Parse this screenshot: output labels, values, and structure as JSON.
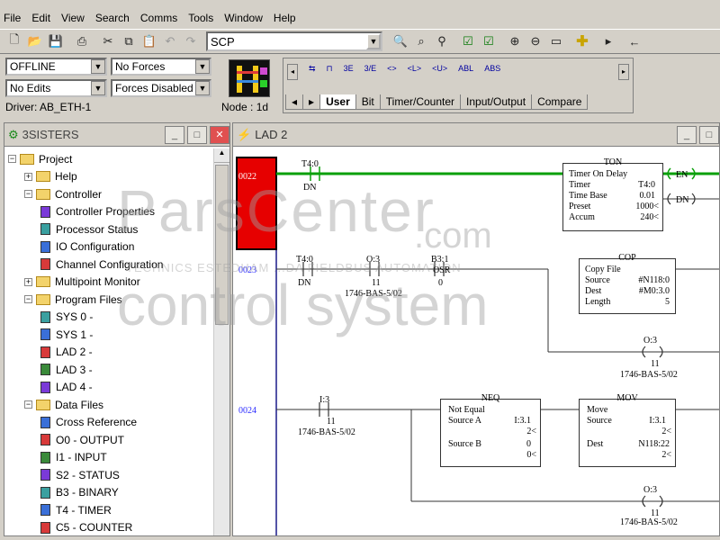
{
  "menu": [
    "File",
    "Edit",
    "View",
    "Search",
    "Comms",
    "Tools",
    "Window",
    "Help"
  ],
  "toolbar": {
    "search_value": "SCP"
  },
  "status": {
    "mode": "OFFLINE",
    "edits": "No Edits",
    "forces": "No Forces",
    "forces_state": "Forces Disabled",
    "driver": "Driver: AB_ETH-1",
    "node": "Node : 1d"
  },
  "instr_icons": [
    "ABL",
    "ABS"
  ],
  "instr_tabs": [
    "User",
    "Bit",
    "Timer/Counter",
    "Input/Output",
    "Compare"
  ],
  "left_pane": {
    "title": "3SISTERS",
    "tree": [
      {
        "label": "Project",
        "level": 0
      },
      {
        "label": "Help",
        "level": 1
      },
      {
        "label": "Controller",
        "level": 1
      },
      {
        "label": "Controller Properties",
        "level": 2
      },
      {
        "label": "Processor Status",
        "level": 2
      },
      {
        "label": "IO Configuration",
        "level": 2
      },
      {
        "label": "Channel Configuration",
        "level": 2
      },
      {
        "label": "Multipoint Monitor",
        "level": 1
      },
      {
        "label": "Program Files",
        "level": 1
      },
      {
        "label": "SYS 0 -",
        "level": 2
      },
      {
        "label": "SYS 1 -",
        "level": 2
      },
      {
        "label": "LAD 2 -",
        "level": 2
      },
      {
        "label": "LAD 3 -",
        "level": 2
      },
      {
        "label": "LAD 4 -",
        "level": 2
      },
      {
        "label": "Data Files",
        "level": 1
      },
      {
        "label": "Cross Reference",
        "level": 2
      },
      {
        "label": "O0 - OUTPUT",
        "level": 2
      },
      {
        "label": "I1 - INPUT",
        "level": 2
      },
      {
        "label": "S2 - STATUS",
        "level": 2
      },
      {
        "label": "B3 - BINARY",
        "level": 2
      },
      {
        "label": "T4 - TIMER",
        "level": 2
      },
      {
        "label": "C5 - COUNTER",
        "level": 2
      }
    ]
  },
  "right_pane": {
    "title": "LAD 2",
    "rungs": {
      "r22": "0022",
      "r23": "0023",
      "r24": "0024"
    },
    "ton": {
      "name": "TON",
      "desc": "Timer On Delay",
      "timer_k": "Timer",
      "timer_v": "T4:0",
      "base_k": "Time Base",
      "base_v": "0.01",
      "preset_k": "Preset",
      "preset_v": "1000<",
      "accum_k": "Accum",
      "accum_v": "240<",
      "en": "EN",
      "dn": "DN"
    },
    "cop": {
      "name": "COP",
      "desc": "Copy File",
      "src_k": "Source",
      "src_v": "#N118:0",
      "dest_k": "Dest",
      "dest_v": "#M0:3.0",
      "len_k": "Length",
      "len_v": "5"
    },
    "neq": {
      "name": "NEQ",
      "desc": "Not Equal",
      "a_k": "Source A",
      "a_v": "I:3.1",
      "a_val": "2<",
      "b_k": "Source B",
      "b_v": "0",
      "b_val": "0<"
    },
    "mov": {
      "name": "MOV",
      "desc": "Move",
      "src_k": "Source",
      "src_v": "I:3.1",
      "src_val": "2<",
      "dest_k": "Dest",
      "dest_v": "N118:22",
      "dest_val": "2<"
    },
    "contacts": {
      "c1_tag": "T4:0",
      "c1_bit": "DN",
      "c2_tag": "T4:0",
      "c2_bit": "DN",
      "c3_tag": "O:3",
      "c3_bit": "11",
      "c3_dev": "1746-BAS-5/02",
      "c4_tag": "B3:1",
      "c4_bit": "0",
      "c4_label": "OSR",
      "c5_tag": "I:3",
      "c5_bit": "11",
      "c5_dev": "1746-BAS-5/02",
      "o1_tag": "O:3",
      "o1_bit": "11",
      "o1_dev": "1746-BAS-5/02",
      "o2_tag": "O:3",
      "o2_bit": "11",
      "o2_dev": "1746-BAS-5/02"
    }
  },
  "watermark": {
    "line1": "ParsCenter",
    "line2": ".com",
    "line3": "TECHNICS ESTEDHAM ...DA FIELDBUS AUTOMATION",
    "line4": "control system"
  }
}
